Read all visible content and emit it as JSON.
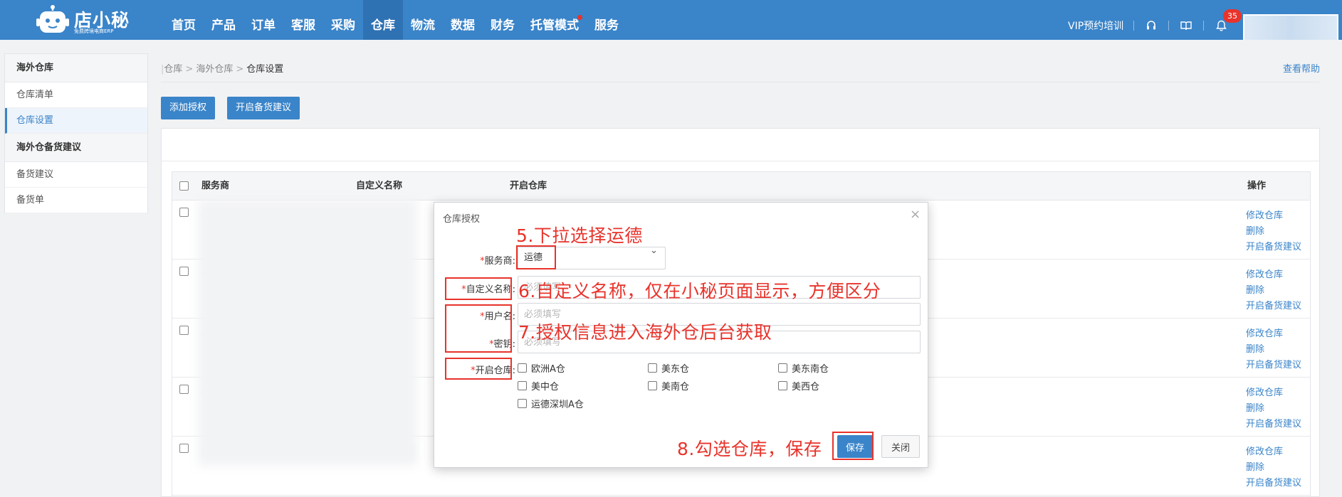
{
  "logo": {
    "name": "店小秘",
    "tagline": "免费跨境电商ERP"
  },
  "nav": {
    "items": [
      {
        "label": "首页"
      },
      {
        "label": "产品"
      },
      {
        "label": "订单"
      },
      {
        "label": "客服"
      },
      {
        "label": "采购"
      },
      {
        "label": "仓库"
      },
      {
        "label": "物流"
      },
      {
        "label": "数据"
      },
      {
        "label": "财务"
      },
      {
        "label": "托管模式"
      },
      {
        "label": "服务"
      }
    ],
    "active": "仓库",
    "vip_label": "VIP预约培训",
    "notification_count": "35"
  },
  "sidebar": {
    "groups": [
      {
        "title": "海外仓库",
        "items": [
          {
            "label": "仓库清单"
          },
          {
            "label": "仓库设置",
            "active": true
          }
        ]
      },
      {
        "title": "海外仓备货建议",
        "items": [
          {
            "label": "备货建议"
          },
          {
            "label": "备货单"
          }
        ]
      }
    ]
  },
  "breadcrumb": {
    "root": "仓库",
    "parent": "海外仓库",
    "current": "仓库设置"
  },
  "help_link": "查看帮助",
  "toolbar": {
    "add_auth": "添加授权",
    "open_stock": "开启备货建议"
  },
  "table": {
    "columns": {
      "provider": "服务商",
      "custom_name": "自定义名称",
      "open_warehouse": "开启仓库",
      "actions": "操作"
    },
    "row_actions": {
      "edit": "修改仓库",
      "delete": "删除",
      "open_stock": "开启备货建议"
    },
    "row_count": 5
  },
  "modal": {
    "title": "仓库授权",
    "provider_label": "服务商:",
    "provider_value": "运德",
    "custom_name_label": "自定义名称:",
    "custom_name_placeholder": "必须填写",
    "username_label": "用户名:",
    "username_placeholder": "必须填写",
    "secret_label": "密钥:",
    "secret_placeholder": "必须填写",
    "warehouse_label": "开启仓库:",
    "warehouses": [
      "欧洲A仓",
      "美东仓",
      "美东南仓",
      "美中仓",
      "美南仓",
      "美西仓",
      "运德深圳A仓"
    ],
    "save": "保存",
    "close": "关闭"
  },
  "annotations": {
    "step5": "5.下拉选择运德",
    "step6": "6.自定义名称，仅在小秘页面显示，方便区分",
    "step7": "7.授权信息进入海外仓后台获取",
    "step8": "8.勾选仓库，保存"
  },
  "colors": {
    "primary": "#3a84c9",
    "annotation": "#e8332b",
    "badge": "#e8332b"
  }
}
